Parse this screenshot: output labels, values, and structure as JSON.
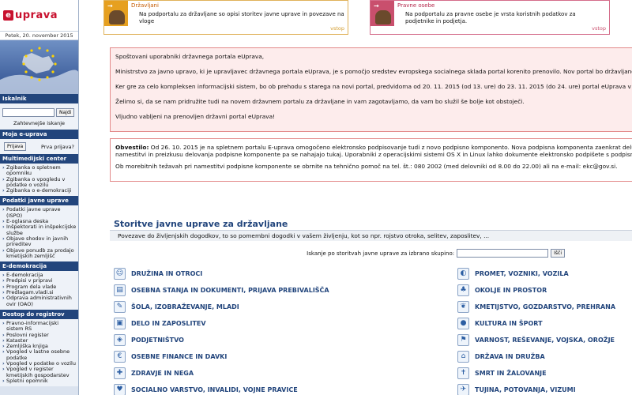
{
  "brand": {
    "logo_mark": "e",
    "logo_text": "uprava"
  },
  "date": "Petek, 20. november 2015",
  "sidebar": {
    "search": {
      "heading": "Iskalnik",
      "button": "Najdi",
      "advanced": "Zahtevnejše iskanje"
    },
    "login": {
      "heading": "Moja e-uprava",
      "button": "Prijava",
      "help": "Prva prijava?"
    },
    "sections": [
      {
        "heading": "Multimedijski center",
        "items": [
          "Zgibanka o spletnem opomniku",
          "Zgibanka o vpogledu v podatke o vozilu",
          "Zgibanka o e-demokraciji"
        ]
      },
      {
        "heading": "Podatki javne uprave",
        "items": [
          "Podatki javne uprave (ISPO)",
          "E-oglasna deska",
          "Inšpektorati in inšpekcijske službe",
          "Objave shodov in javnih prireditev",
          "Objave ponudb za prodajo kmetijskih zemljišč"
        ]
      },
      {
        "heading": "E-demokracija",
        "items": [
          "E-demokracija",
          "Predpisi v pripravi",
          "Program dela vlade",
          "Predlagam.vladi.si",
          "Odprava administrativnih ovir (OAO)"
        ]
      },
      {
        "heading": "Dostop do registrov",
        "items": [
          "Pravno-informacijski sistem RS",
          "Poslovni register",
          "Kataster",
          "Zemljiška knjiga",
          "Vpogled v lastne osebne podatke",
          "Vpogled v podatke o vozilu",
          "Vpogled v register kmetijskih gospodarstev",
          "Spletni opomnik"
        ]
      }
    ]
  },
  "top_boxes": [
    {
      "title": "Državljani",
      "text": "Na podportalu za državljane so opisi storitev javne uprave in povezave na vloge",
      "more": "vstop"
    },
    {
      "title": "Pravne osebe",
      "text": "Na podportalu za pravne osebe je vrsta koristnih podatkov za podjetnike in podjetja.",
      "more": "vstop"
    }
  ],
  "welcome": [
    "Spoštovani uporabniki državnega portala eUprava,",
    "Ministrstvo za javno upravo, ki je upravljavec državnega portala eUprava, je s pomočjo sredstev evropskega socialnega sklada portal korenito prenovilo. Nov portal bo državljanom dost",
    "Ker gre za celo kompleksen informacijski sistem, bo ob prehodu s starega na novi portal, predvidoma od 20. 11. 2015 (od 13. ure) do 23. 11. 2015 (do 24. ure) portal eUprava v celoti nedosegljiv",
    "Želimo si, da se nam pridružite tudi na novem državnem portalu za državljane in vam zagotavljamo, da vam bo služil še bolje kot obstoječi.",
    "Vljudno vabljeni na prenovljen državni portal eUprava!"
  ],
  "warning": {
    "label": "Obvestilo:",
    "line1": " Od 26. 10. 2015 je na spletnem portalu E-uprava omogočeno elektronsko podpisovanje tudi z novo podpisno komponento. Nova podpisna komponenta zaenkrat deluje v najpogostej",
    "line2": "namestitvi in preizkusu delovanja podpisne komponente pa se nahajajo tukaj. Uporabniki z operacijskimi sistemi OS X in Linux lahko dokumente elektronsko podpišete s podpisno komponento prej",
    "line3": "Ob morebitnih težavah pri namestitvi podpisne komponente se obrnite na tehnično pomoč na tel. št.: 080 2002 (med delovniki od 8.00 do 22.00) ali na e-mail: ekc@gov.si."
  },
  "services": {
    "title": "Storitve javne uprave za državljane",
    "subtitle": "Povezave do življenjskih dogodkov, to so pomembni dogodki v vašem življenju, kot so npr. rojstvo otroka, selitev, zaposlitev, ...",
    "search_label": "Iskanje po storitvah javne uprave za izbrano skupino:",
    "search_button": "Išči",
    "left": [
      {
        "label": "DRUŽINA IN OTROCI",
        "icon": "family-icon",
        "glyph": "☺"
      },
      {
        "label": "OSEBNA STANJA IN DOKUMENTI, PRIJAVA PREBIVALIŠČA",
        "icon": "documents-icon",
        "glyph": "▤"
      },
      {
        "label": "ŠOLA, IZOBRAŽEVANJE, MLADI",
        "icon": "school-icon",
        "glyph": "✎"
      },
      {
        "label": "DELO IN ZAPOSLITEV",
        "icon": "work-icon",
        "glyph": "▣"
      },
      {
        "label": "PODJETNIŠTVO",
        "icon": "business-icon",
        "glyph": "◈"
      },
      {
        "label": "OSEBNE FINANCE IN DAVKI",
        "icon": "finance-icon",
        "glyph": "€"
      },
      {
        "label": "ZDRAVJE IN NEGA",
        "icon": "health-icon",
        "glyph": "✚"
      },
      {
        "label": "SOCIALNO VARSTVO, INVALIDI, VOJNE PRAVICE",
        "icon": "social-care-icon",
        "glyph": "♥"
      }
    ],
    "right": [
      {
        "label": "PROMET, VOZNIKI, VOZILA",
        "icon": "traffic-icon",
        "glyph": "◐"
      },
      {
        "label": "OKOLJE IN PROSTOR",
        "icon": "environment-icon",
        "glyph": "♣"
      },
      {
        "label": "KMETIJSTVO, GOZDARSTVO, PREHRANA",
        "icon": "agriculture-icon",
        "glyph": "❦"
      },
      {
        "label": "KULTURA IN ŠPORT",
        "icon": "culture-icon",
        "glyph": "●"
      },
      {
        "label": "VARNOST, REŠEVANJE, VOJSKA, OROŽJE",
        "icon": "security-icon",
        "glyph": "⚑"
      },
      {
        "label": "DRŽAVA IN DRUŽBA",
        "icon": "state-icon",
        "glyph": "⌂"
      },
      {
        "label": "SMRT IN ŽALOVANJE",
        "icon": "mourning-icon",
        "glyph": "✝"
      },
      {
        "label": "TUJINA, POTOVANJA, VIZUMI",
        "icon": "travel-icon",
        "glyph": "✈"
      }
    ]
  },
  "colors": {
    "brand_red": "#c8102e",
    "nav_blue": "#22457c",
    "notice_pink": "#fdecec",
    "gold": "#e6a020"
  }
}
